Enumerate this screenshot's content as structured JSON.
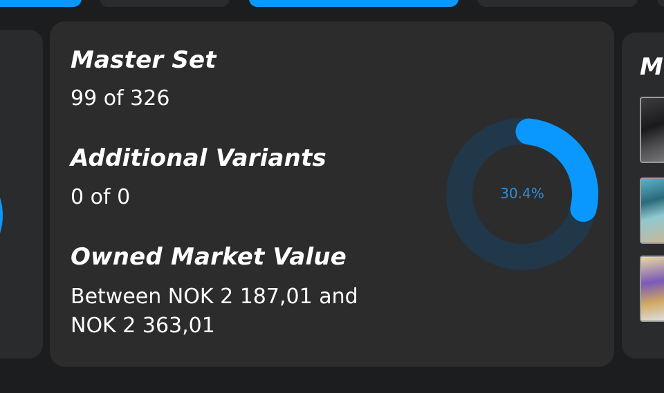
{
  "cards": [
    {
      "title": "Master Set",
      "value": "99 of 326"
    },
    {
      "title": "Additional Variants",
      "value": "0 of 0"
    },
    {
      "title": "Owned Market Value",
      "value": "Between NOK 2 187,01 and NOK 2 363,01"
    }
  ],
  "progress": {
    "label": "30.4%",
    "fraction": 0.304,
    "track_color": "#21374a",
    "fill_color": "#0a98ff"
  },
  "right_card": {
    "title_fragment": "M",
    "thumbnails": [
      "card-thumbnail",
      "card-thumbnail",
      "card-thumbnail"
    ]
  },
  "colors": {
    "accent": "#0a98ff",
    "card_bg": "#2c2c2d",
    "page_bg": "#1c1d1f"
  }
}
